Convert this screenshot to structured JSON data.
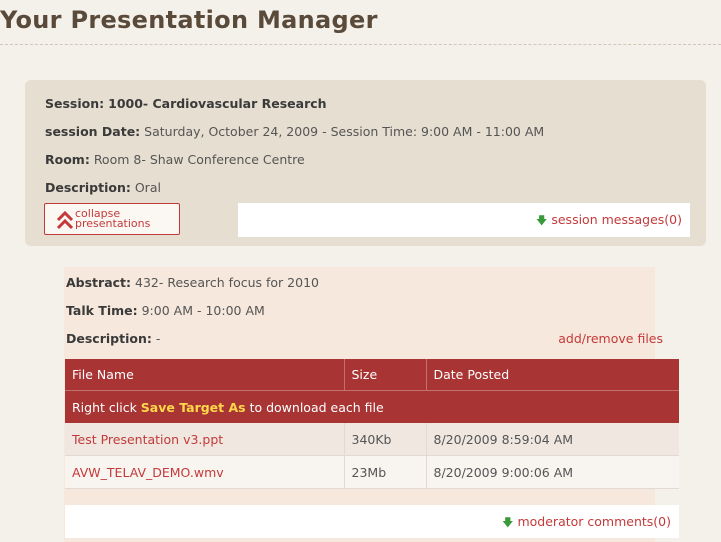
{
  "page": {
    "title": "Your Presentation Manager"
  },
  "session": {
    "session_label": "Session:",
    "session_value": "1000- Cardiovascular Research",
    "date_label": "session Date:",
    "date_value": "Saturday, October 24, 2009 - Session Time: 9:00 AM - 11:00 AM",
    "room_label": "Room:",
    "room_value": "Room 8- Shaw Conference Centre",
    "description_label": "Description:",
    "description_value": "Oral",
    "collapse_line1": "collapse",
    "collapse_line2": "presentations",
    "messages_link": "session messages(0)"
  },
  "abstract": {
    "abstract_label": "Abstract:",
    "abstract_value": "432- Research focus for 2010",
    "talk_label": "Talk Time:",
    "talk_value": "9:00 AM - 10:00 AM",
    "description_label": "Description:",
    "description_value": "-",
    "add_remove_link": "add/remove files",
    "moderator_link": "moderator comments(0)"
  },
  "files_table": {
    "headers": [
      "File Name",
      "Size",
      "Date Posted"
    ],
    "instruction_prefix": "Right click ",
    "instruction_bold": "Save Target As",
    "instruction_suffix": " to download each file",
    "rows": [
      {
        "name": "Test Presentation v3.ppt",
        "size": "340Kb",
        "date": "8/20/2009 8:59:04 AM"
      },
      {
        "name": "AVW_TELAV_DEMO.wmv",
        "size": "23Mb",
        "date": "8/20/2009 9:00:06 AM"
      }
    ]
  },
  "colors": {
    "accent_red": "#c43a3a",
    "table_header": "#a93434",
    "highlight_yellow": "#ffd84a",
    "download_arrow_green": "#3a9a3a"
  },
  "icons": {
    "collapse": "double-chevron-up-icon",
    "link_arrow": "green-down-arrow-icon"
  }
}
